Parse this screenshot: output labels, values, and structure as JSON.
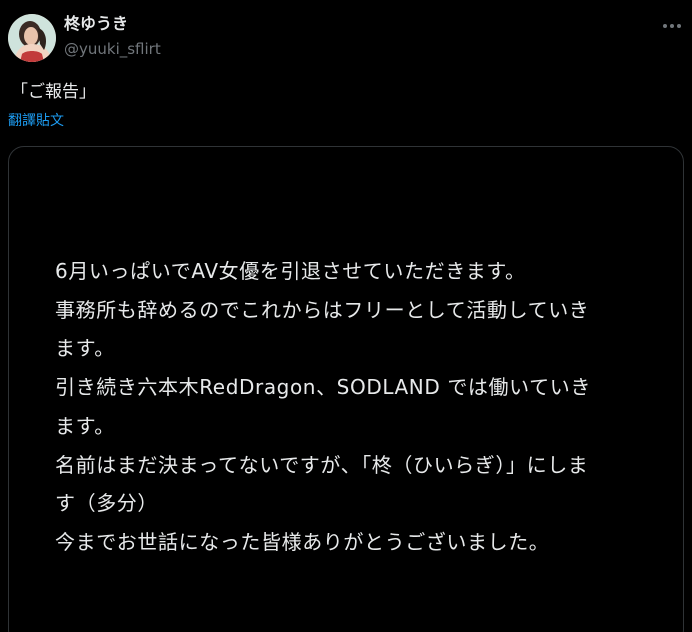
{
  "author": {
    "display_name": "柊ゆうき",
    "handle": "@yuuki_sflirt",
    "avatar": "avatar-photo"
  },
  "tweet": {
    "text": "「ご報告」",
    "translate_label": "翻譯貼文"
  },
  "icons": {
    "more": "more-options-icon"
  },
  "media": {
    "lines": [
      "6月いっぱいでAV女優を引退させていただきます。",
      "事務所も辞めるのでこれからはフリーとして活動していき",
      "ます。",
      "引き続き六本木RedDragon、SODLAND では働いていき",
      "ます。",
      "名前はまだ決まってないですが、「柊（ひいらぎ）」にしま",
      "す（多分）",
      "今までお世話になった皆様ありがとうございました。"
    ]
  },
  "colors": {
    "background": "#000000",
    "text": "#e7e9ea",
    "secondary_text": "#71767b",
    "link": "#1d9bf0",
    "border": "#2f3336"
  }
}
